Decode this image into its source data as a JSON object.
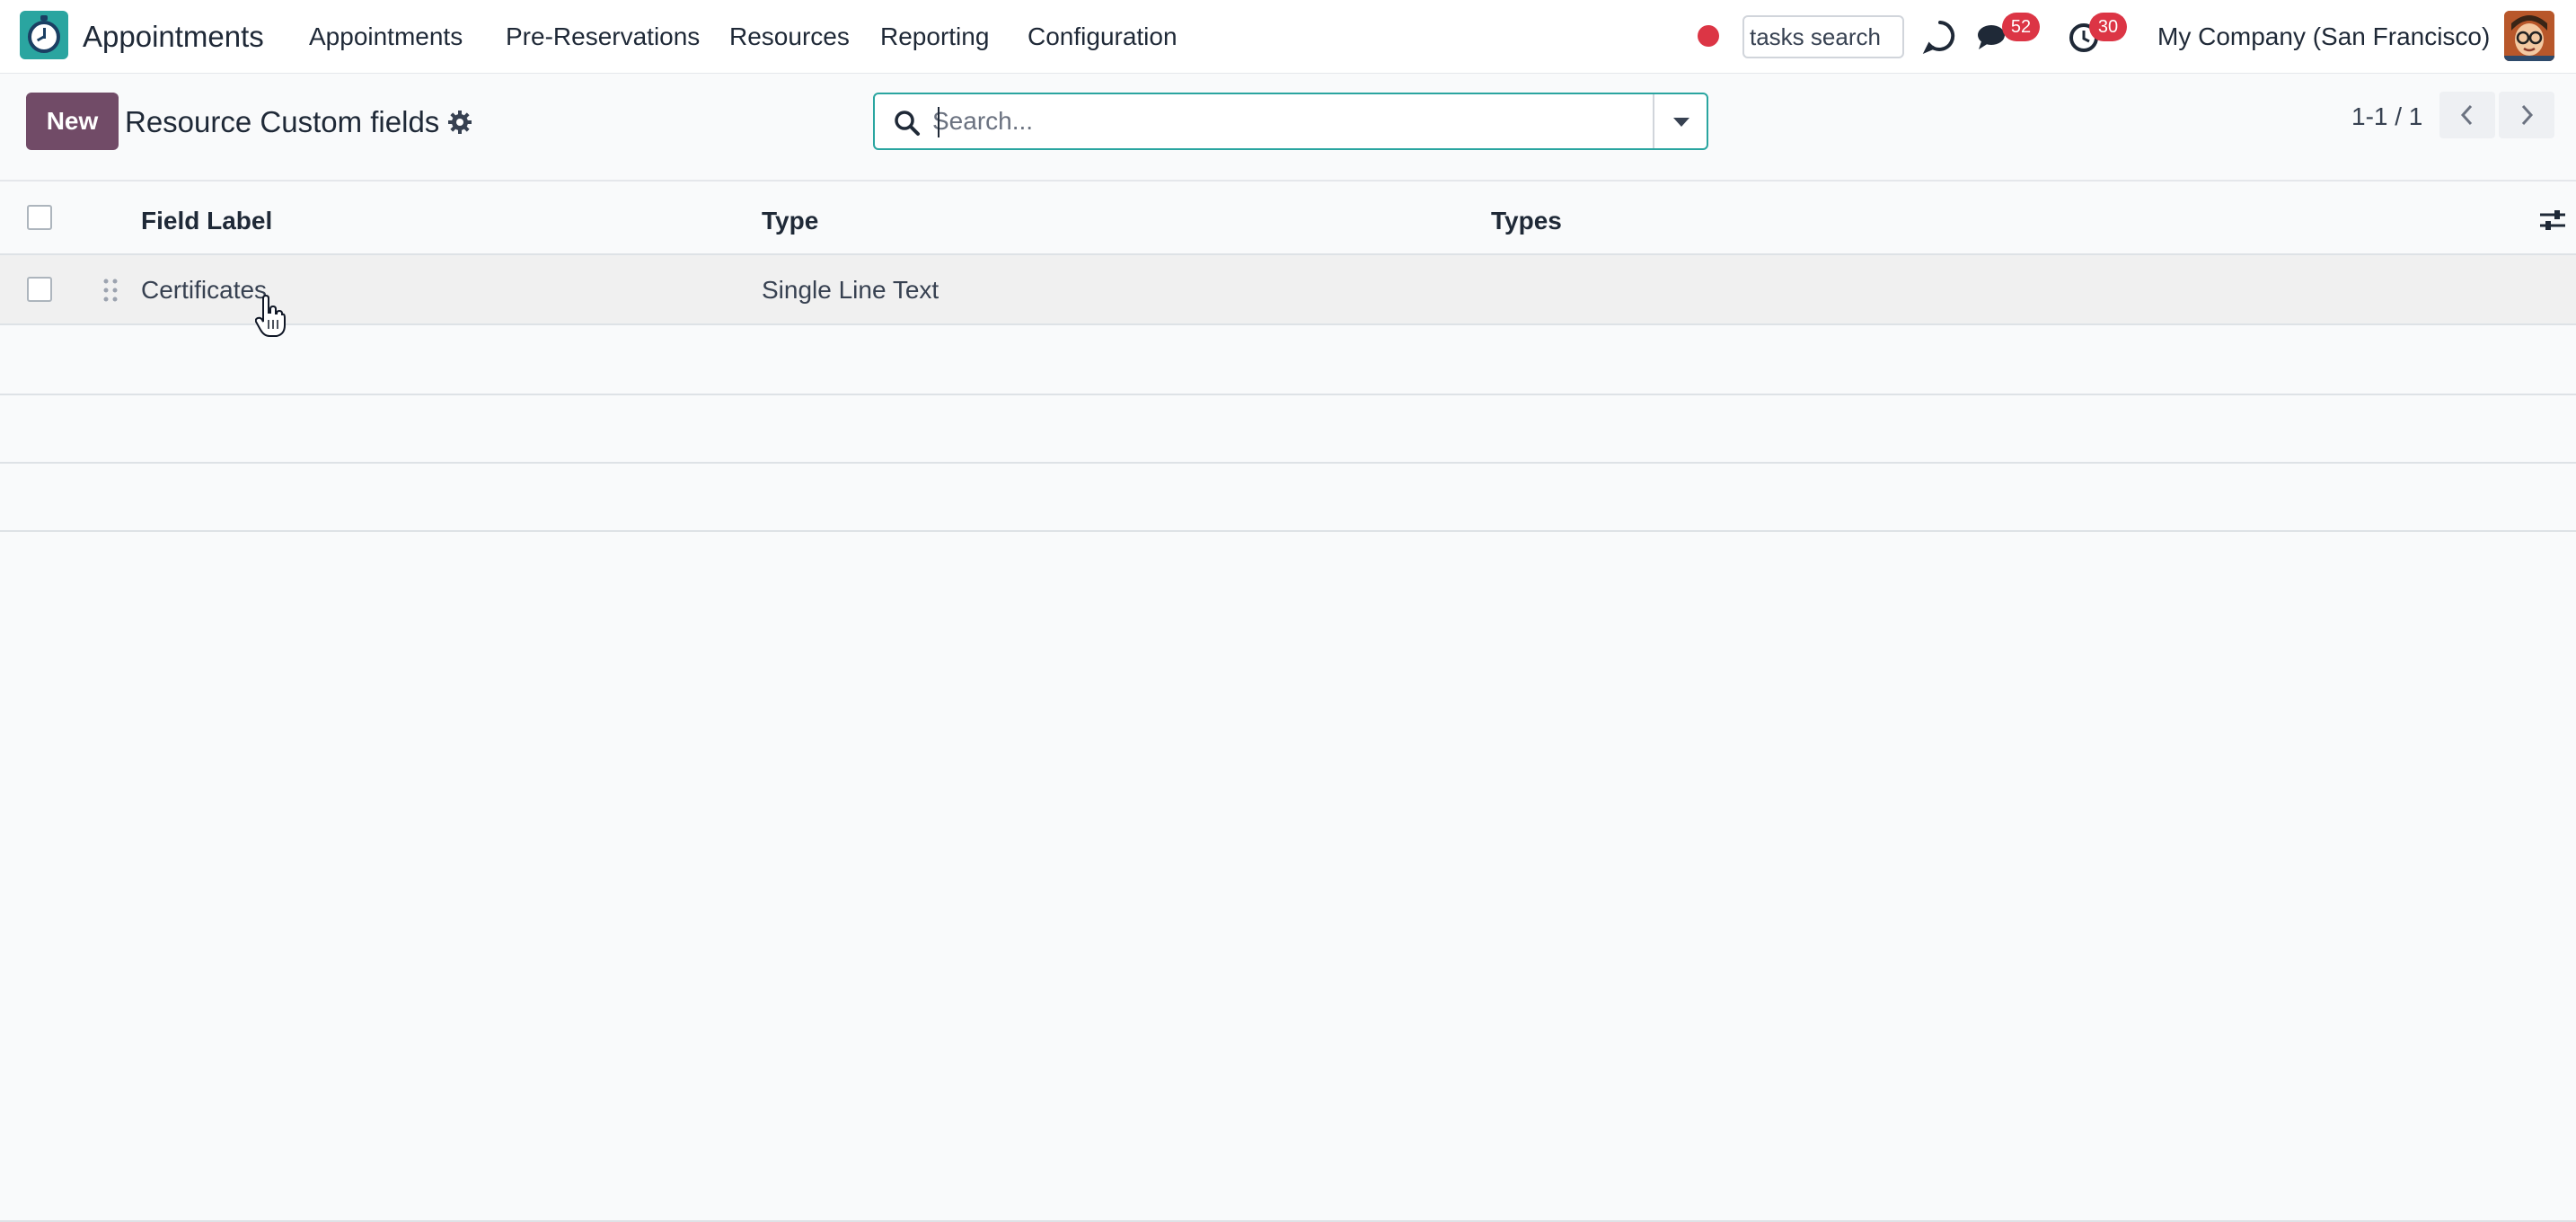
{
  "app": {
    "name": "Appointments",
    "logo_icon": "appointments-clock-icon"
  },
  "menu": [
    {
      "label": "Appointments"
    },
    {
      "label": "Pre-Reservations"
    },
    {
      "label": "Resources"
    },
    {
      "label": "Reporting"
    },
    {
      "label": "Configuration"
    }
  ],
  "systray": {
    "tasks_search": "tasks search",
    "discuss_badge": "52",
    "activities_badge": "30",
    "company": "My Company (San Francisco)",
    "status_color": "#dc3545"
  },
  "control_panel": {
    "new_label": "New",
    "title": "Resource Custom fields",
    "search_placeholder": "Search...",
    "pager": "1-1 / 1"
  },
  "list": {
    "columns": [
      "Field Label",
      "Type",
      "Types"
    ],
    "rows": [
      {
        "field_label": "Certificates",
        "type": "Single Line Text",
        "types": ""
      }
    ]
  },
  "colors": {
    "brand": "#714b67",
    "accent": "#2aa5a0",
    "badge": "#dc3545"
  }
}
